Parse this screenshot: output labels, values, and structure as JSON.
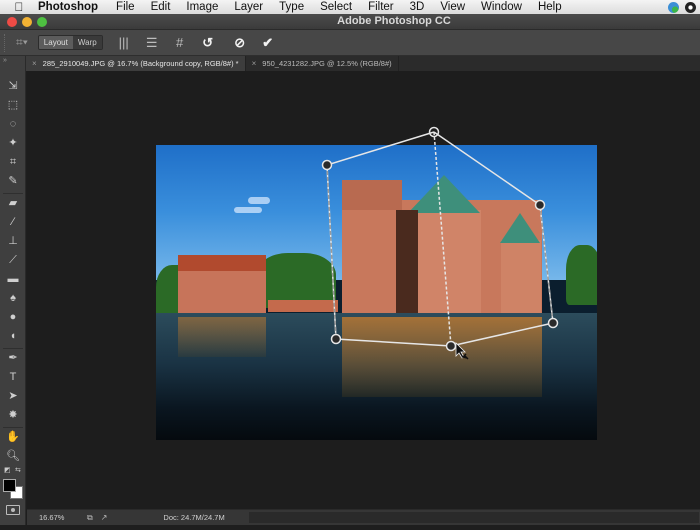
{
  "menubar": {
    "apple_icon": "apple-logo",
    "app_name": "Photoshop",
    "items": [
      "File",
      "Edit",
      "Image",
      "Layer",
      "Type",
      "Select",
      "Filter",
      "3D",
      "View",
      "Window",
      "Help"
    ],
    "tray_icons": [
      "creative-cloud-sync-icon",
      "time-machine-icon"
    ]
  },
  "window": {
    "title": "Adobe Photoshop CC",
    "traffic_lights": {
      "close": "#ee4b45",
      "minimize": "#f2b233",
      "zoom": "#4ec041"
    }
  },
  "options_bar": {
    "tool_preset_icon": "puppet-warp-icon",
    "segments": [
      {
        "label": "Layout",
        "active": true
      },
      {
        "label": "Warp",
        "active": false
      }
    ],
    "actions": [
      {
        "name": "split-vertical",
        "glyph": "|||"
      },
      {
        "name": "split-horizontal",
        "glyph": "☰"
      },
      {
        "name": "split-grid",
        "glyph": "#"
      },
      {
        "name": "reset",
        "glyph": "↺"
      },
      {
        "name": "cancel",
        "glyph": "⊘"
      },
      {
        "name": "commit",
        "glyph": "✔"
      }
    ]
  },
  "tabs": [
    {
      "label": "285_2910049.JPG @ 16.7% (Background copy, RGB/8#) *",
      "close": "×",
      "active": true
    },
    {
      "label": "950_4231282.JPG @ 12.5% (RGB/8#)",
      "close": "×",
      "active": false
    }
  ],
  "toolbar": {
    "collapse_label": "»",
    "tools": [
      {
        "name": "move",
        "glyph": "⇲"
      },
      {
        "name": "rectangular-marquee",
        "glyph": "⬚"
      },
      {
        "name": "lasso",
        "glyph": "◌"
      },
      {
        "name": "magic-wand",
        "glyph": "✦"
      },
      {
        "name": "crop",
        "glyph": "⌗"
      },
      {
        "name": "eyedropper",
        "glyph": "✎"
      },
      {
        "name": "spot-healing",
        "glyph": "▰"
      },
      {
        "name": "brush",
        "glyph": "∕"
      },
      {
        "name": "clone-stamp",
        "glyph": "⊥"
      },
      {
        "name": "history-brush",
        "glyph": "⟋"
      },
      {
        "name": "eraser",
        "glyph": "▬"
      },
      {
        "name": "paint-bucket",
        "glyph": "♠"
      },
      {
        "name": "blur",
        "glyph": "●"
      },
      {
        "name": "dodge",
        "glyph": "◖"
      },
      {
        "name": "pen",
        "glyph": "✒"
      },
      {
        "name": "type",
        "glyph": "T"
      },
      {
        "name": "path-selection",
        "glyph": "➤"
      },
      {
        "name": "custom-shape",
        "glyph": "✸"
      },
      {
        "name": "hand",
        "glyph": "✋"
      },
      {
        "name": "zoom",
        "glyph": "🔍︎"
      }
    ],
    "default_colors_glyph": "◩",
    "swap_colors_glyph": "⇆",
    "foreground_color": "#000000",
    "background_color": "#ffffff"
  },
  "canvas": {
    "image_subject": "Egeskov castle reflected in moat",
    "transform_mode": "Perspective Warp - Layout",
    "sky_color": "#2f86d8",
    "water_color": "#12283a"
  },
  "status_bar": {
    "zoom": "16.67%",
    "doc": "Doc: 24.7M/24.7M",
    "arrow": "▶"
  }
}
